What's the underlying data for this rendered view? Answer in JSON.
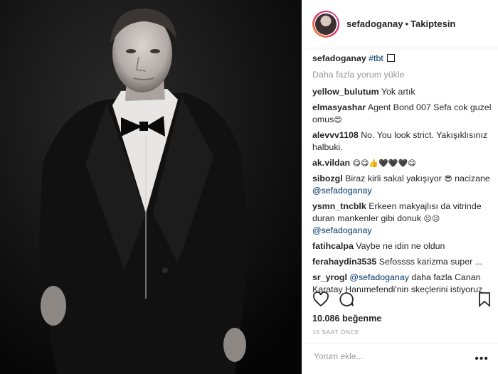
{
  "post": {
    "username": "sefadoganay",
    "follow_status": "Takiptesin",
    "separator": "•",
    "caption_user": "sefadoganay",
    "caption_tag": "#tbt",
    "load_more": "Daha fazla yorum yükle",
    "likes": "10.086 beğenme",
    "time": "15 SAAT ÖNCE",
    "comment_placeholder": "Yorum ekle...",
    "more_options": "•••"
  },
  "comments": [
    {
      "user": "yellow_bulutum",
      "text": "Yok artık",
      "emoji": "",
      "mention": "",
      "text2": ""
    },
    {
      "user": "elmasyashar",
      "text": "Agent Bond 007 Sefa cok guzel omus",
      "emoji": "😍",
      "mention": "",
      "text2": ""
    },
    {
      "user": "alevvv1108",
      "text": "No. You look strict. Yakışıklısınız halbuki.",
      "emoji": "",
      "mention": "",
      "text2": ""
    },
    {
      "user": "ak.vildan",
      "text": "",
      "emoji": "😋😋👍🖤🖤🖤😋",
      "mention": "",
      "text2": ""
    },
    {
      "user": "sibozgl",
      "text": "Biraz kirli sakal yakışıyor",
      "emoji": "😎",
      "mention": "@sefadoganay",
      "text2": "nacizane"
    },
    {
      "user": "ysmn_tncblk",
      "text": "Erkeen makyajlısı da vitrinde duran mankenler gibi donuk",
      "emoji": "😣😣",
      "mention": "@sefadoganay",
      "text2": ""
    },
    {
      "user": "fatihcalpa",
      "text": "Vaybe ne idin ne oldun",
      "emoji": "",
      "mention": "",
      "text2": ""
    },
    {
      "user": "ferahaydin3535",
      "text": "Sefossss karizma super ...",
      "emoji": "",
      "mention": "",
      "text2": ""
    },
    {
      "user": "sr_yrogl",
      "text": "daha fazla Canan Karatay Hanımefendi'nin skeçlerini istiyoruz",
      "emoji": "",
      "mention": "@sefadoganay",
      "text2": ""
    }
  ]
}
